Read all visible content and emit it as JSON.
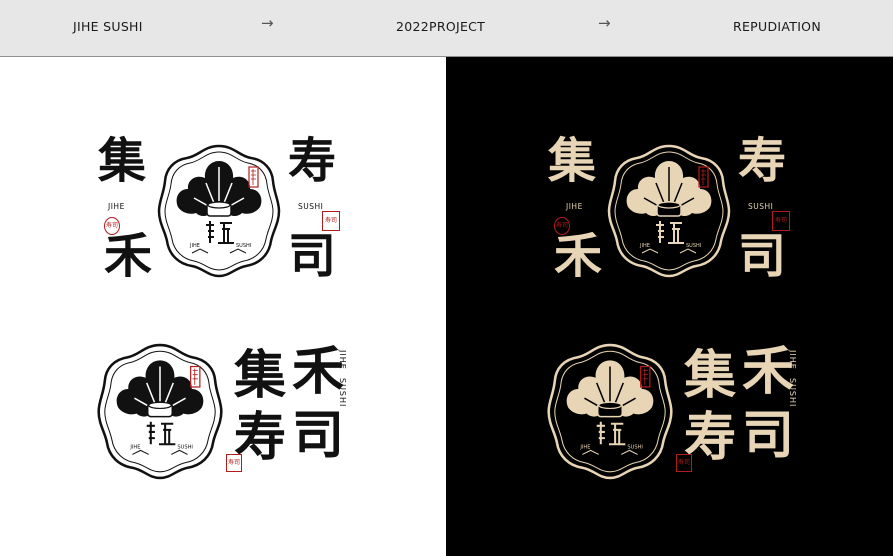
{
  "header": {
    "left_label": "JIHE SUSHI",
    "center_label": "2022PROJECT",
    "right_label": "REPUDIATION",
    "arrow_glyph": "→"
  },
  "logo": {
    "char_ji": "集",
    "char_he": "禾",
    "char_shou": "寿",
    "char_si": "司",
    "en_jihe": "JIHE",
    "en_sushi": "SUSHI",
    "badge_jihe": "JIHE",
    "badge_sushi": "SUSHI",
    "seal_text": "寿司"
  },
  "colors": {
    "header_bg": "#e7e7e7",
    "light_bg": "#ffffff",
    "dark_bg": "#000000",
    "ink": "#111111",
    "cream": "#e8d5b5",
    "seal_red": "#b31c1c"
  }
}
